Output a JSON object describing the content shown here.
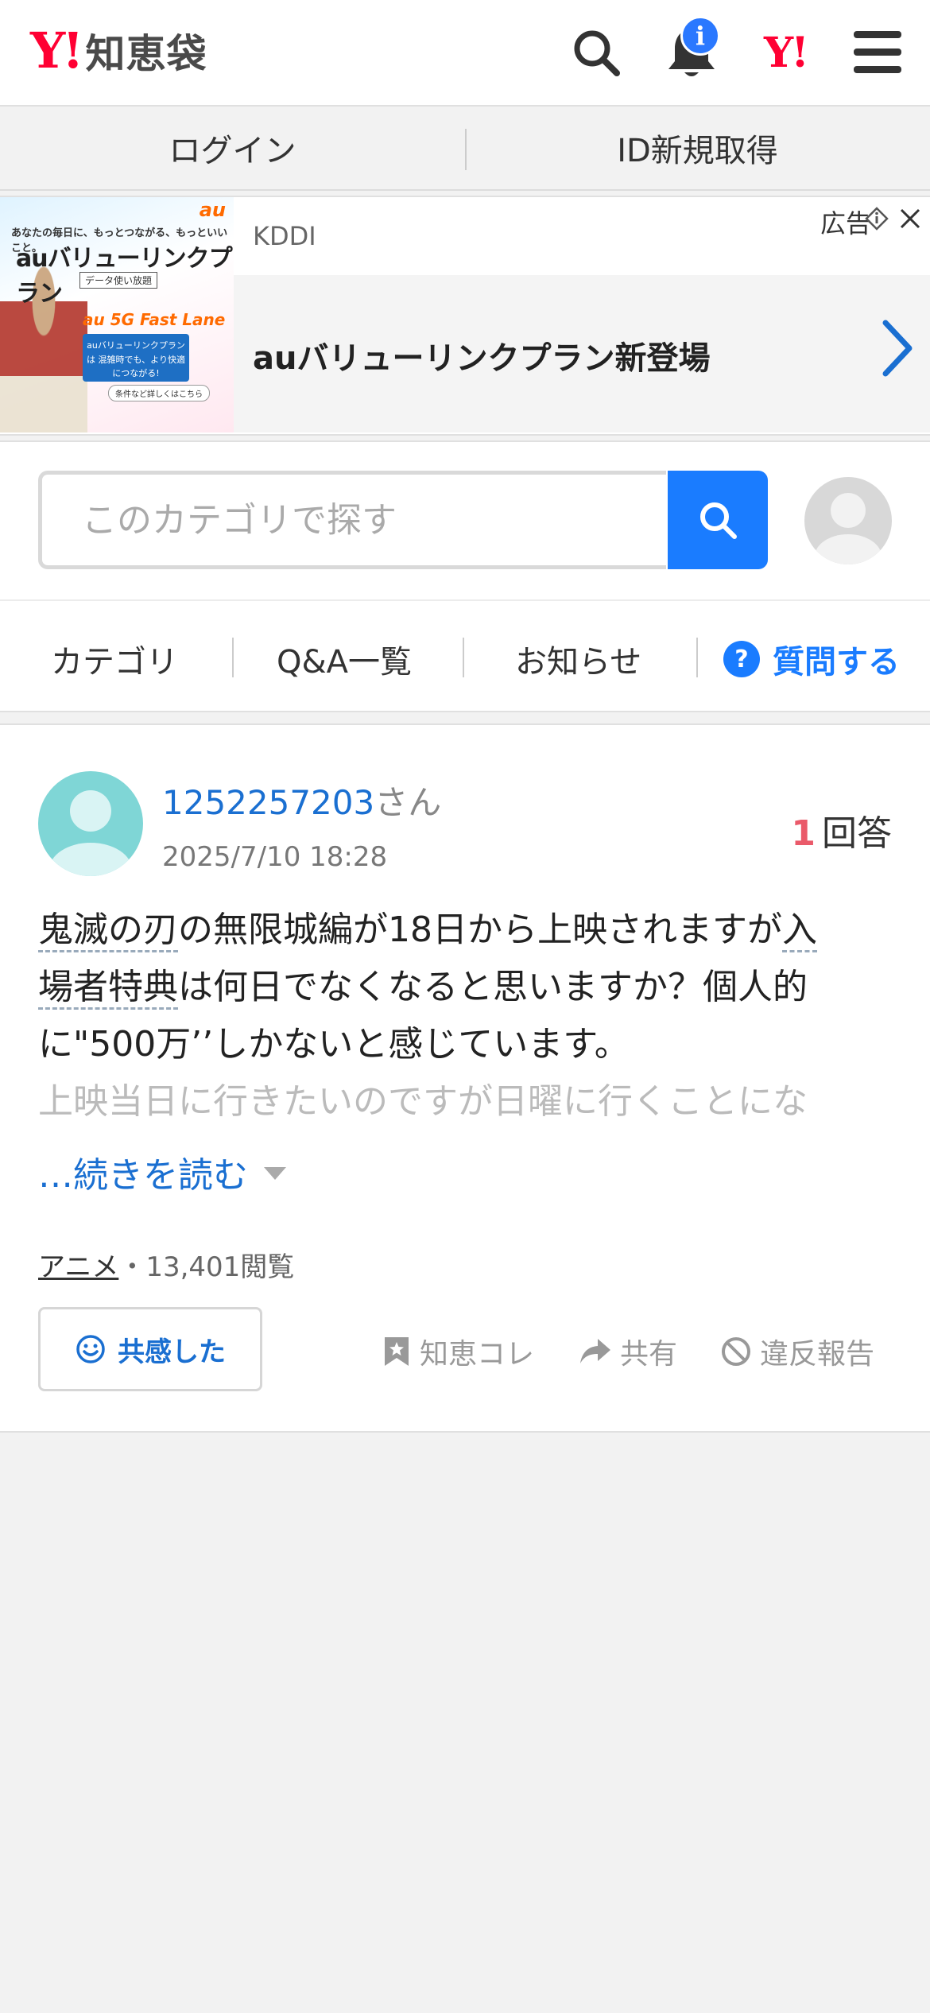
{
  "header": {
    "logo_y": "Y!",
    "logo_text": "知恵袋",
    "notification_badge": "i",
    "yahoo_link": "Y!"
  },
  "loginbar": {
    "login": "ログイン",
    "register": "ID新規取得"
  },
  "ad": {
    "sponsor": "KDDI",
    "label": "広告",
    "title": "auバリューリンクプラン新登場",
    "image_text": {
      "tagline": "あなたの毎日に、もっとつながる、もっといいこと。",
      "plan": "auバリューリンクプラン",
      "sub": "データ使い放題",
      "brand": "au",
      "fastlane": "au 5G Fast Lane",
      "box": "auバリューリンクプランは 混雑時でも、より快適につながる!",
      "cta": "条件など詳しくはこちら"
    }
  },
  "search": {
    "placeholder": "このカテゴリで探す"
  },
  "nav": {
    "category": "カテゴリ",
    "qa_list": "Q&A一覧",
    "news": "お知らせ",
    "ask": "質問する"
  },
  "question": {
    "user_id": "1252257203",
    "user_suffix": "さん",
    "date": "2025/7/10 18:28",
    "answer_count": "1",
    "answer_label": "回答",
    "body_parts": {
      "link1": "鬼滅の刃",
      "text1": "の無限城編が18日から上映されますが",
      "link2_a": "入",
      "link2_b": "場者特典",
      "text2": "は何日でなくなると思いますか？個人的に\"500万’’しかないと感じています。",
      "faded": "上映当日に行きたいのですが日曜に行くことにな"
    },
    "read_more": "…続きを読む",
    "category": "アニメ",
    "views": "・13,401閲覧",
    "empathy_button": "共感した",
    "bookmark": "知恵コレ",
    "share": "共有",
    "report": "違反報告"
  },
  "colors": {
    "yahoo_red": "#ff0033",
    "link_blue": "#1a6fd1",
    "accent_blue": "#1a7cff",
    "answer_count": "#ea5a6a"
  }
}
